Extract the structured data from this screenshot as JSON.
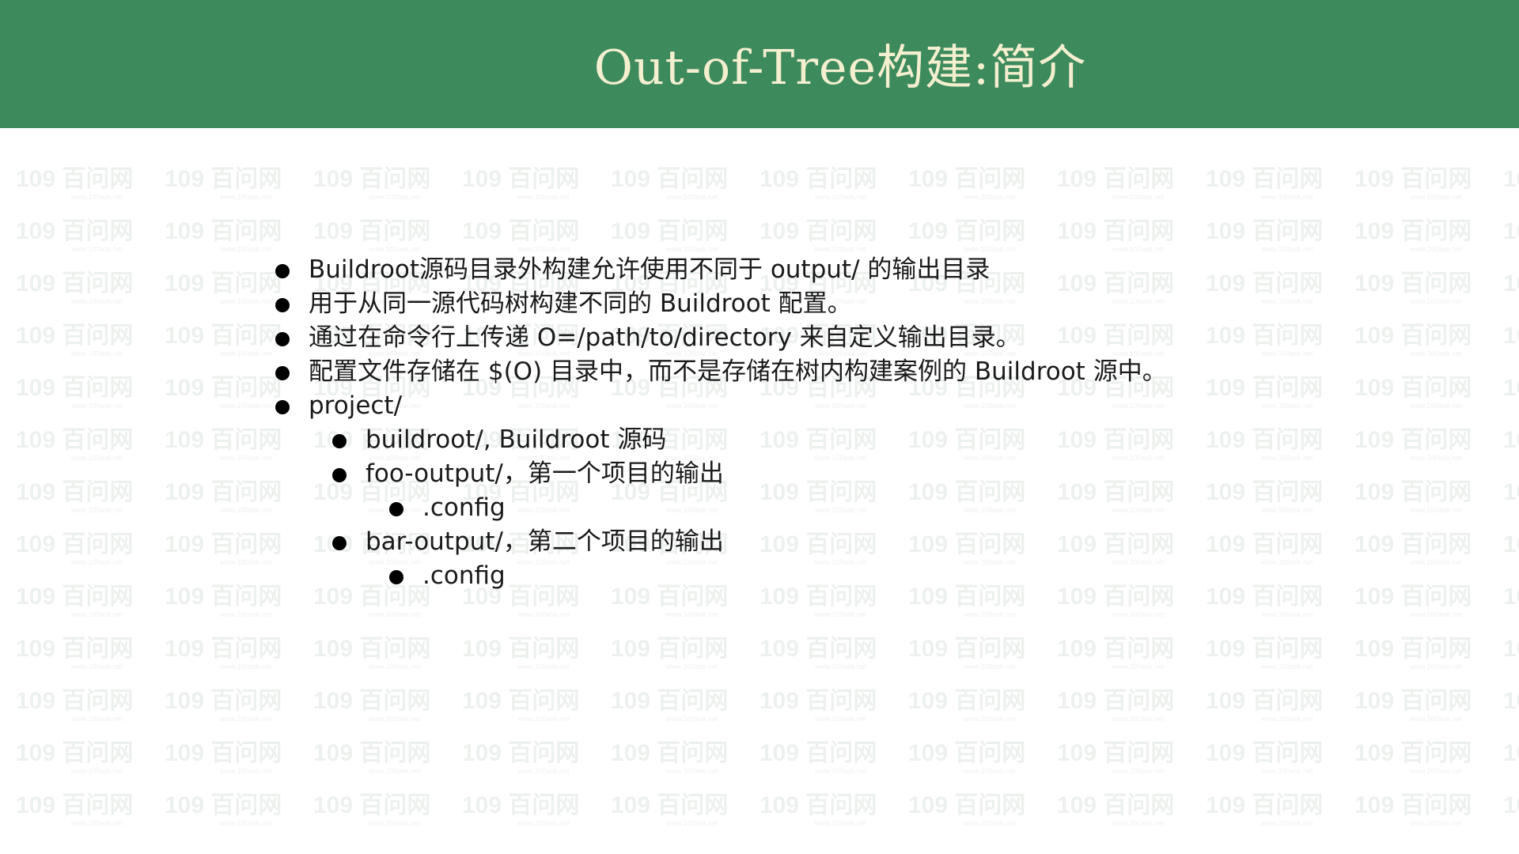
{
  "slide": {
    "title": "Out-of-Tree构建:简介",
    "bullets": [
      {
        "level": 0,
        "text": "Buildroot源码目录外构建允许使用不同于 output/ 的输出目录"
      },
      {
        "level": 0,
        "text": "用于从同一源代码树构建不同的 Buildroot 配置。"
      },
      {
        "level": 0,
        "text": "通过在命令行上传递 O=/path/to/directory 来自定义输出目录。"
      },
      {
        "level": 0,
        "text": "配置文件存储在 $(O) 目录中，而不是存储在树内构建案例的 Buildroot 源中。"
      },
      {
        "level": 0,
        "text": "project/"
      },
      {
        "level": 1,
        "text": "buildroot/, Buildroot 源码"
      },
      {
        "level": 1,
        "text": "foo-output/，第一个项目的输出"
      },
      {
        "level": 2,
        "text": ".config"
      },
      {
        "level": 1,
        "text": "bar-output/，第二个项目的输出"
      },
      {
        "level": 2,
        "text": ".config"
      }
    ]
  },
  "watermark": {
    "text": "109 百问网",
    "url": "www.100ask.net"
  },
  "colors": {
    "header_background": "#3d8a5c",
    "title_text": "#f3efcf",
    "body_text": "#1a1a1a",
    "watermark": "#dfe7e1"
  }
}
